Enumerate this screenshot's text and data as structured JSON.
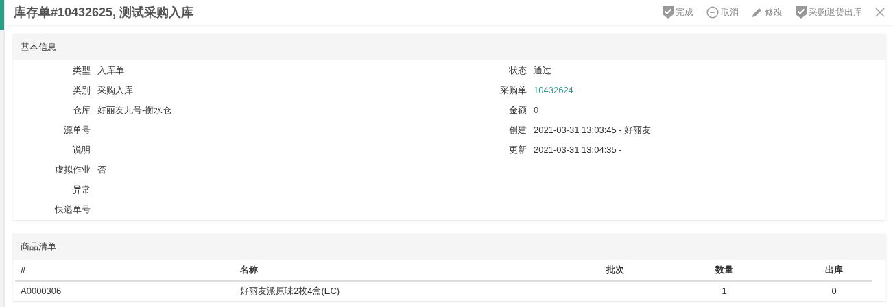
{
  "dialog": {
    "title": "库存单#10432625, 测试采购入库"
  },
  "actions": [
    {
      "kind": "check",
      "label": "完成"
    },
    {
      "kind": "minus",
      "label": "取消"
    },
    {
      "kind": "pencil",
      "label": "修改"
    },
    {
      "kind": "check",
      "label": "采购退货出库"
    }
  ],
  "basic_info": {
    "title": "基本信息",
    "left_fields": [
      {
        "label": "类型",
        "value": "入库单"
      },
      {
        "label": "类别",
        "value": "采购入库"
      },
      {
        "label": "仓库",
        "value": "好丽友九号-衡水仓"
      },
      {
        "label": "源单号"
      },
      {
        "label": "说明"
      },
      {
        "label": "虚拟作业",
        "value": "否"
      },
      {
        "label": "异常"
      },
      {
        "label": "快递单号"
      }
    ],
    "right_fields": [
      {
        "label": "状态",
        "value": "通过"
      },
      {
        "label": "采购单",
        "value": "10432624",
        "kind": "link"
      },
      {
        "label": "金额",
        "value": "0"
      },
      {
        "label": "创建",
        "value": "2021-03-31 13:03:45 - 好丽友"
      },
      {
        "label": "更新",
        "value": "2021-03-31 13:04:35 -"
      }
    ]
  },
  "items": {
    "title": "商品清单",
    "columns": [
      "#",
      "名称",
      "批次",
      "数量",
      "出库"
    ],
    "rows": [
      [
        "A0000306",
        "好丽友派原味2枚4盒(EC)",
        "",
        "1",
        "0"
      ]
    ]
  }
}
